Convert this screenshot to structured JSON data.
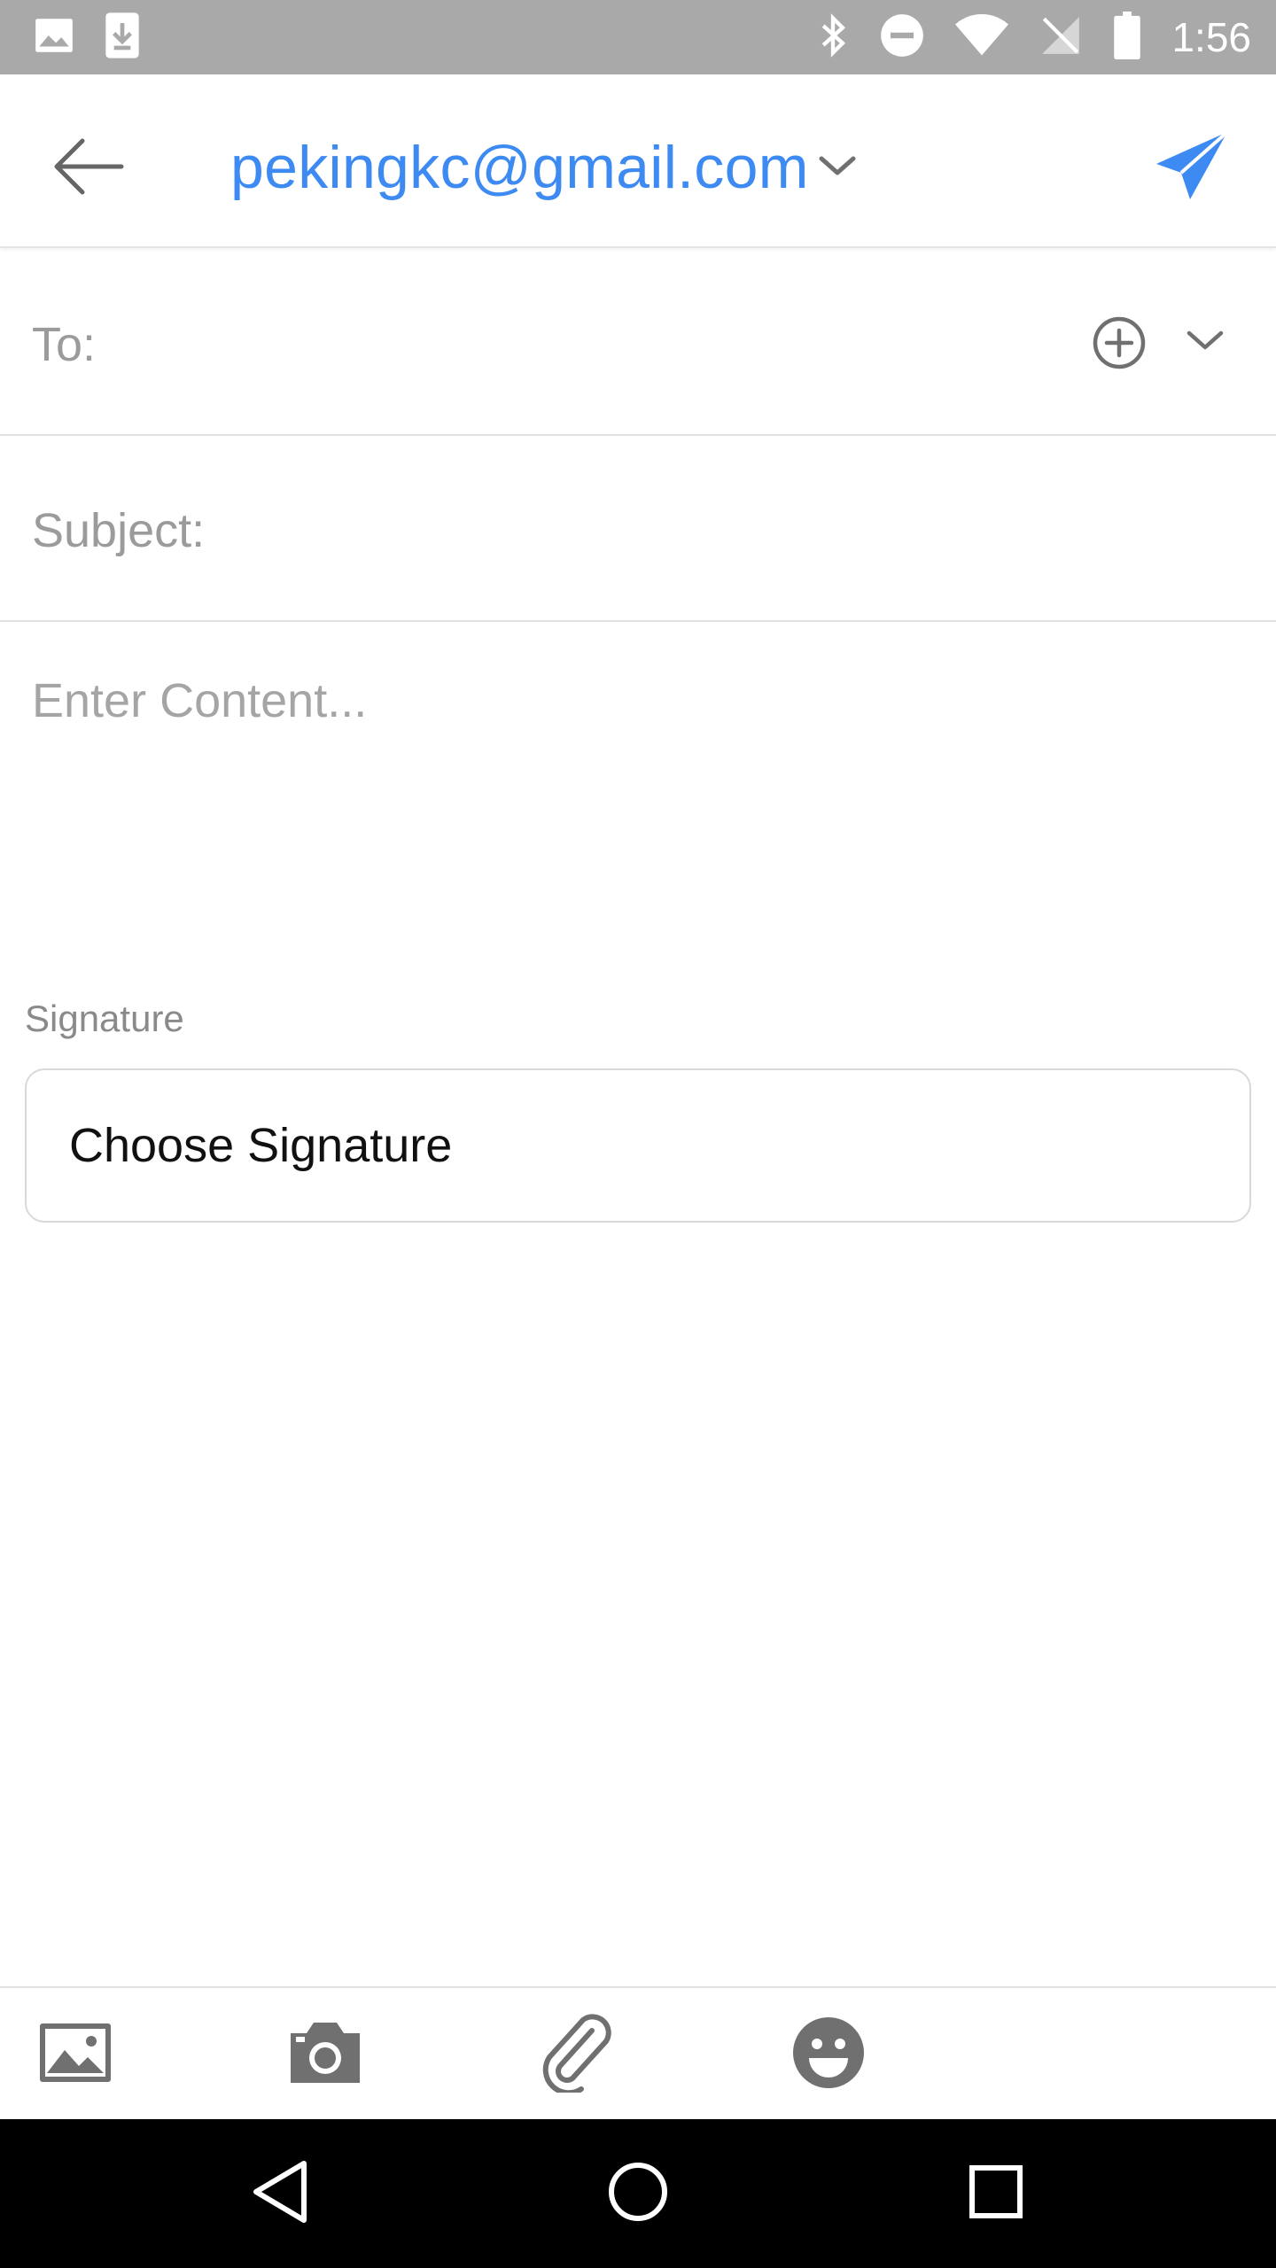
{
  "status_bar": {
    "time": "1:56",
    "icons": [
      "image-notification-icon",
      "download-notification-icon",
      "bluetooth-icon",
      "do-not-disturb-icon",
      "wifi-icon",
      "no-sim-icon",
      "battery-icon"
    ]
  },
  "app_bar": {
    "back_icon": "arrow-left-icon",
    "account_email": "pekingkc@gmail.com",
    "dropdown_icon": "chevron-down-icon",
    "send_icon": "paper-plane-icon"
  },
  "compose": {
    "to_label": "To:",
    "to_value": "",
    "subject_label": "Subject:",
    "subject_value": "",
    "content_placeholder": "Enter Content...",
    "content_value": ""
  },
  "signature": {
    "label": "Signature",
    "button_text": "Choose Signature"
  },
  "toolbar": {
    "icons": [
      "image-icon",
      "camera-icon",
      "paperclip-icon",
      "emoji-icon"
    ]
  },
  "colors": {
    "accent": "#3d8bf2",
    "status_bar": "#a9a9a9",
    "icon_gray": "#707070",
    "nav_bar": "#000000"
  }
}
